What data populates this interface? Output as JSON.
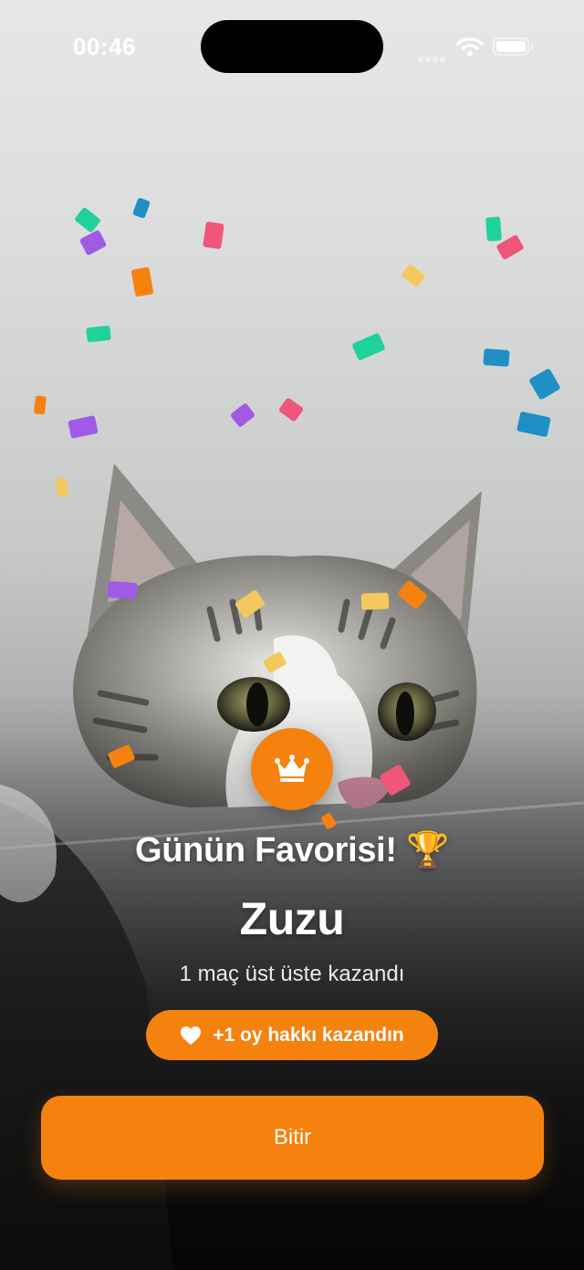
{
  "status_bar": {
    "time": "00:46"
  },
  "win_screen": {
    "title": "Günün Favorisi! 🏆",
    "cat_name": "Zuzu",
    "streak_text": "1 maç üst üste kazandı",
    "reward_label": "+1 oy hakkı kazandın",
    "finish_button_label": "Bitir"
  },
  "colors": {
    "accent": "#f5820f",
    "confetti": [
      "#1fd19a",
      "#a05ae6",
      "#1f8fc6",
      "#f0557a",
      "#f5820f",
      "#f3c95e"
    ]
  },
  "icons": {
    "badge": "crown-icon",
    "reward": "heart-icon",
    "wifi": "wifi-icon",
    "battery": "battery-icon"
  }
}
